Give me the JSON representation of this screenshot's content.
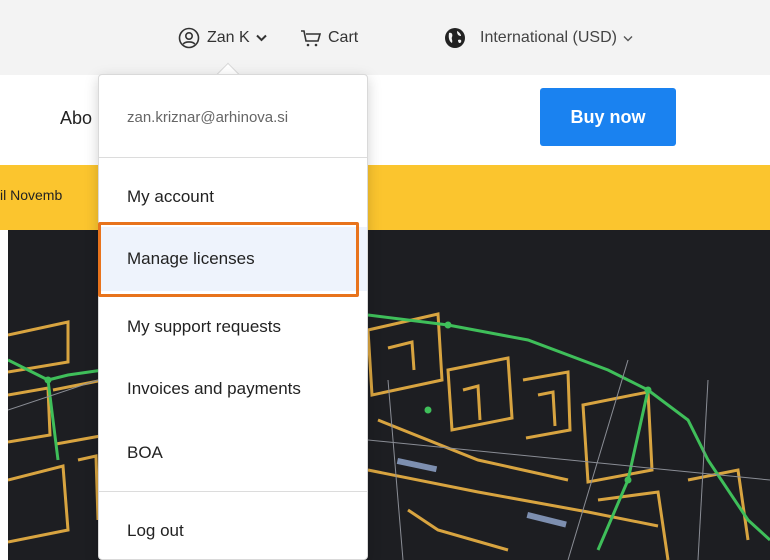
{
  "topbar": {
    "user_label": "Zan K",
    "cart_label": "Cart",
    "region_label": "International (USD)"
  },
  "nav": {
    "about_label": "Abo",
    "buy_label": "Buy now"
  },
  "banner": {
    "text": "il Novemb"
  },
  "dropdown": {
    "email": "zan.kriznar@arhinova.si",
    "items": [
      {
        "label": "My account"
      },
      {
        "label": "Manage licenses"
      },
      {
        "label": "My support requests"
      },
      {
        "label": "Invoices and payments"
      },
      {
        "label": "BOA"
      },
      {
        "label": "Log out"
      }
    ],
    "highlighted_index": 1
  },
  "colors": {
    "accent": "#1a82f0",
    "banner": "#fbc52e",
    "highlight_border": "#e8731c",
    "hero_bg": "#1d1e22",
    "plan_yellow": "#d8a440",
    "plan_green": "#3fbf5a"
  },
  "icons": {
    "user": "user-circle-icon",
    "cart": "cart-icon",
    "region": "globe-icon",
    "chevron": "chevron-down-icon"
  }
}
